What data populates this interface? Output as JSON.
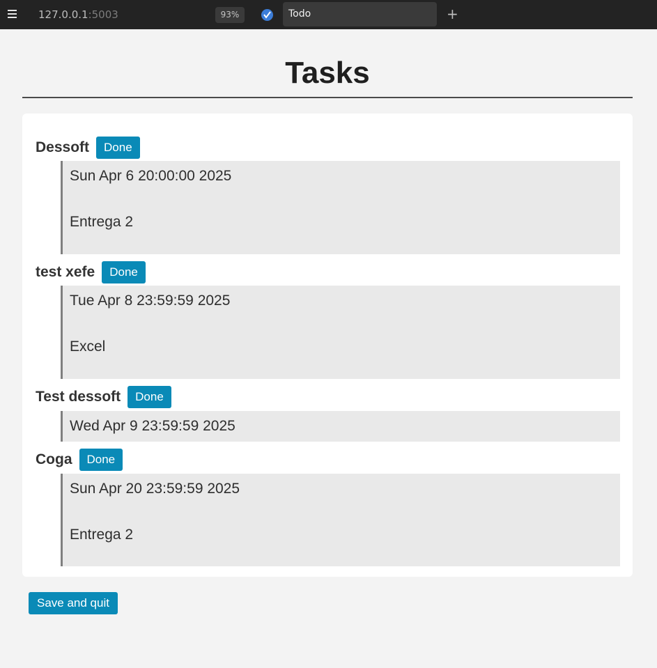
{
  "browser": {
    "url_host": "127.0.0.1",
    "url_port": ":5003",
    "zoom": "93%",
    "tab_title": "Todo",
    "new_tab": "+",
    "icons": [
      "menu-icon",
      "app-icon",
      "new-tab-icon"
    ]
  },
  "page": {
    "title": "Tasks"
  },
  "tasks": [
    {
      "name": "Dessoft",
      "button": "Done",
      "date": "Sun Apr 6 20:00:00 2025",
      "description": "Entrega 2"
    },
    {
      "name": "test xefe",
      "button": "Done",
      "date": "Tue Apr 8 23:59:59 2025",
      "description": "Excel"
    },
    {
      "name": "Test dessoft",
      "button": "Done",
      "date": "Wed Apr 9 23:59:59 2025",
      "description": ""
    },
    {
      "name": "Coga",
      "button": "Done",
      "date": "Sun Apr 20 23:59:59 2025",
      "description": "Entrega 2"
    }
  ],
  "footer": {
    "save_label": "Save and quit"
  },
  "colors": {
    "accent": "#0a8ab7",
    "background": "#f3f3f3",
    "card": "#ffffff",
    "quote_bg": "#e9e9e9"
  }
}
